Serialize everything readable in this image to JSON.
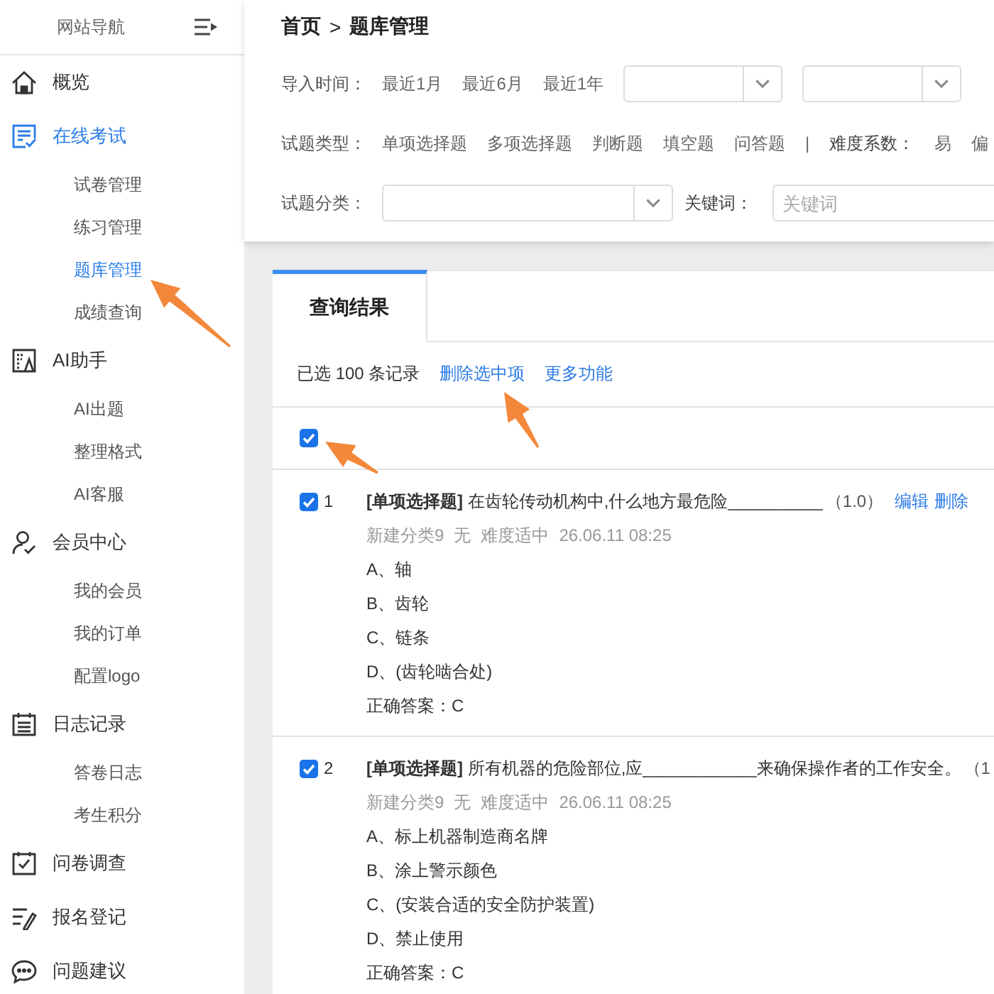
{
  "sidebar": {
    "title": "网站导航",
    "items": [
      {
        "label": "概览",
        "selected": false
      },
      {
        "label": "在线考试",
        "selected": true,
        "children": [
          {
            "label": "试卷管理",
            "selected": false
          },
          {
            "label": "练习管理",
            "selected": false
          },
          {
            "label": "题库管理",
            "selected": true
          },
          {
            "label": "成绩查询",
            "selected": false
          }
        ]
      },
      {
        "label": "AI助手",
        "selected": false,
        "children": [
          {
            "label": "AI出题",
            "selected": false
          },
          {
            "label": "整理格式",
            "selected": false
          },
          {
            "label": "AI客服",
            "selected": false
          }
        ]
      },
      {
        "label": "会员中心",
        "selected": false,
        "children": [
          {
            "label": "我的会员",
            "selected": false
          },
          {
            "label": "我的订单",
            "selected": false
          },
          {
            "label": "配置logo",
            "selected": false
          }
        ]
      },
      {
        "label": "日志记录",
        "selected": false,
        "children": [
          {
            "label": "答卷日志",
            "selected": false
          },
          {
            "label": "考生积分",
            "selected": false
          }
        ]
      },
      {
        "label": "问卷调查",
        "selected": false
      },
      {
        "label": "报名登记",
        "selected": false
      },
      {
        "label": "问题建议",
        "selected": false
      }
    ]
  },
  "breadcrumb": {
    "items": [
      "首页",
      "题库管理"
    ],
    "separator": ">"
  },
  "filters": [
    {
      "label": "导入时间：",
      "controls": [
        {
          "kind": "option",
          "label": "最近1月",
          "selected": false
        },
        {
          "kind": "option",
          "label": "最近6月",
          "selected": false
        },
        {
          "kind": "option",
          "label": "最近1年",
          "selected": false
        },
        {
          "kind": "select"
        },
        {
          "kind": "select"
        }
      ]
    },
    {
      "label": "试题类型：",
      "controls": [
        {
          "kind": "option",
          "label": "单项选择题",
          "selected": false
        },
        {
          "kind": "option",
          "label": "多项选择题",
          "selected": false
        },
        {
          "kind": "option",
          "label": "判断题",
          "selected": false
        },
        {
          "kind": "option",
          "label": "填空题",
          "selected": false
        },
        {
          "kind": "option",
          "label": "问答题",
          "selected": false
        },
        {
          "kind": "separator",
          "label": "|"
        },
        {
          "kind": "label",
          "label": "难度系数："
        },
        {
          "kind": "option",
          "label": "易",
          "selected": false
        },
        {
          "kind": "option",
          "label": "偏",
          "selected": false
        }
      ]
    },
    {
      "label": "试题分类：",
      "controls": [
        {
          "kind": "select"
        },
        {
          "kind": "label",
          "label": "关键词："
        },
        {
          "kind": "input",
          "placeholder": "关键词"
        }
      ]
    }
  ],
  "results": {
    "tab": {
      "label": "查询结果",
      "selected": true
    },
    "summary": "已选 100 条记录",
    "actions": [
      "删除选中项",
      "更多功能"
    ],
    "select_all": {
      "checked": true
    },
    "questions": [
      {
        "checked": true,
        "number": "1",
        "title": "**[单项选择题]** 在齿轮传动机构中,什么地方最危险__________",
        "score": "（1.0）",
        "actions": [
          "编辑",
          "删除"
        ],
        "meta": [
          "新建分类9",
          "无",
          "难度适中",
          "26.06.11 08:25"
        ],
        "options": [
          "A、轴",
          "B、齿轮",
          "C、链条",
          "D、(齿轮啮合处)"
        ],
        "answer": "正确答案：C"
      },
      {
        "checked": true,
        "number": "2",
        "title": "**[单项选择题]** 所有机器的危险部位,应____________来确保操作者的工作安全。",
        "score": "（1",
        "meta": [
          "新建分类9",
          "无",
          "难度适中",
          "26.06.11 08:25"
        ],
        "options": [
          "A、标上机器制造商名牌",
          "B、涂上警示颜色",
          "C、(安装合适的安全防护装置)",
          "D、禁止使用"
        ],
        "answer": "正确答案：C"
      }
    ]
  }
}
